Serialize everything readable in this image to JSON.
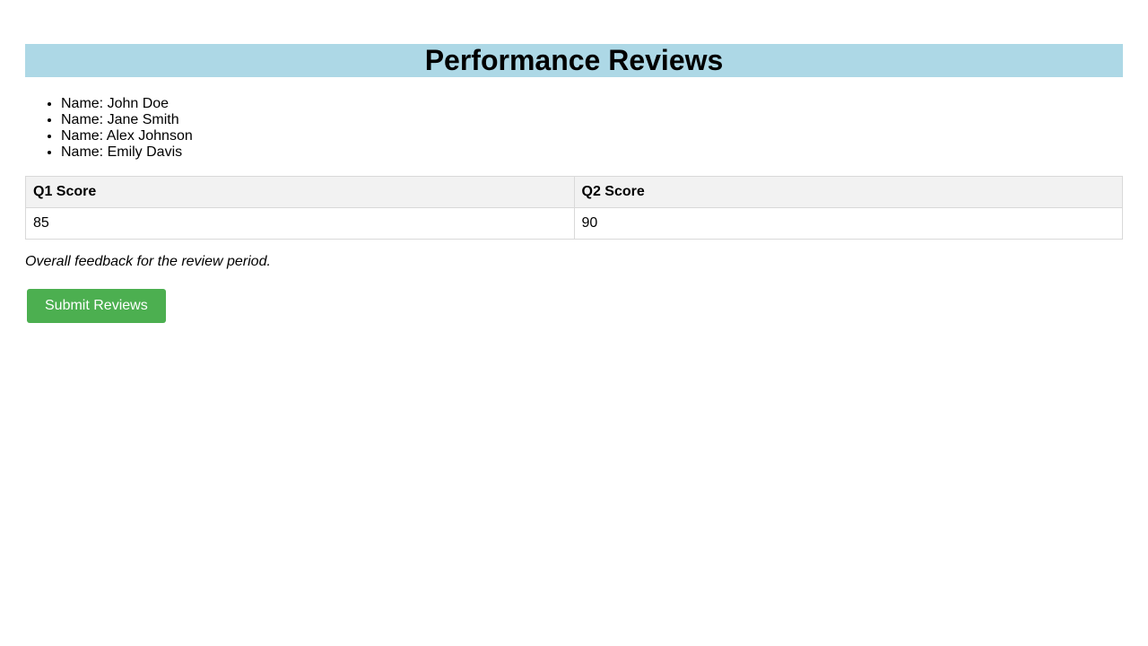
{
  "page": {
    "title": "Performance Reviews"
  },
  "employees": [
    {
      "label": "Name: John Doe"
    },
    {
      "label": "Name: Jane Smith"
    },
    {
      "label": "Name: Alex Johnson"
    },
    {
      "label": "Name: Emily Davis"
    }
  ],
  "scores_table": {
    "headers": [
      "Q1 Score",
      "Q2 Score"
    ],
    "rows": [
      [
        "85",
        "90"
      ]
    ]
  },
  "feedback": "Overall feedback for the review period.",
  "actions": {
    "submit_label": "Submit Reviews"
  },
  "colors": {
    "title_bg": "#add8e6",
    "button_bg": "#4caf50",
    "table_header_bg": "#f2f2f2"
  }
}
